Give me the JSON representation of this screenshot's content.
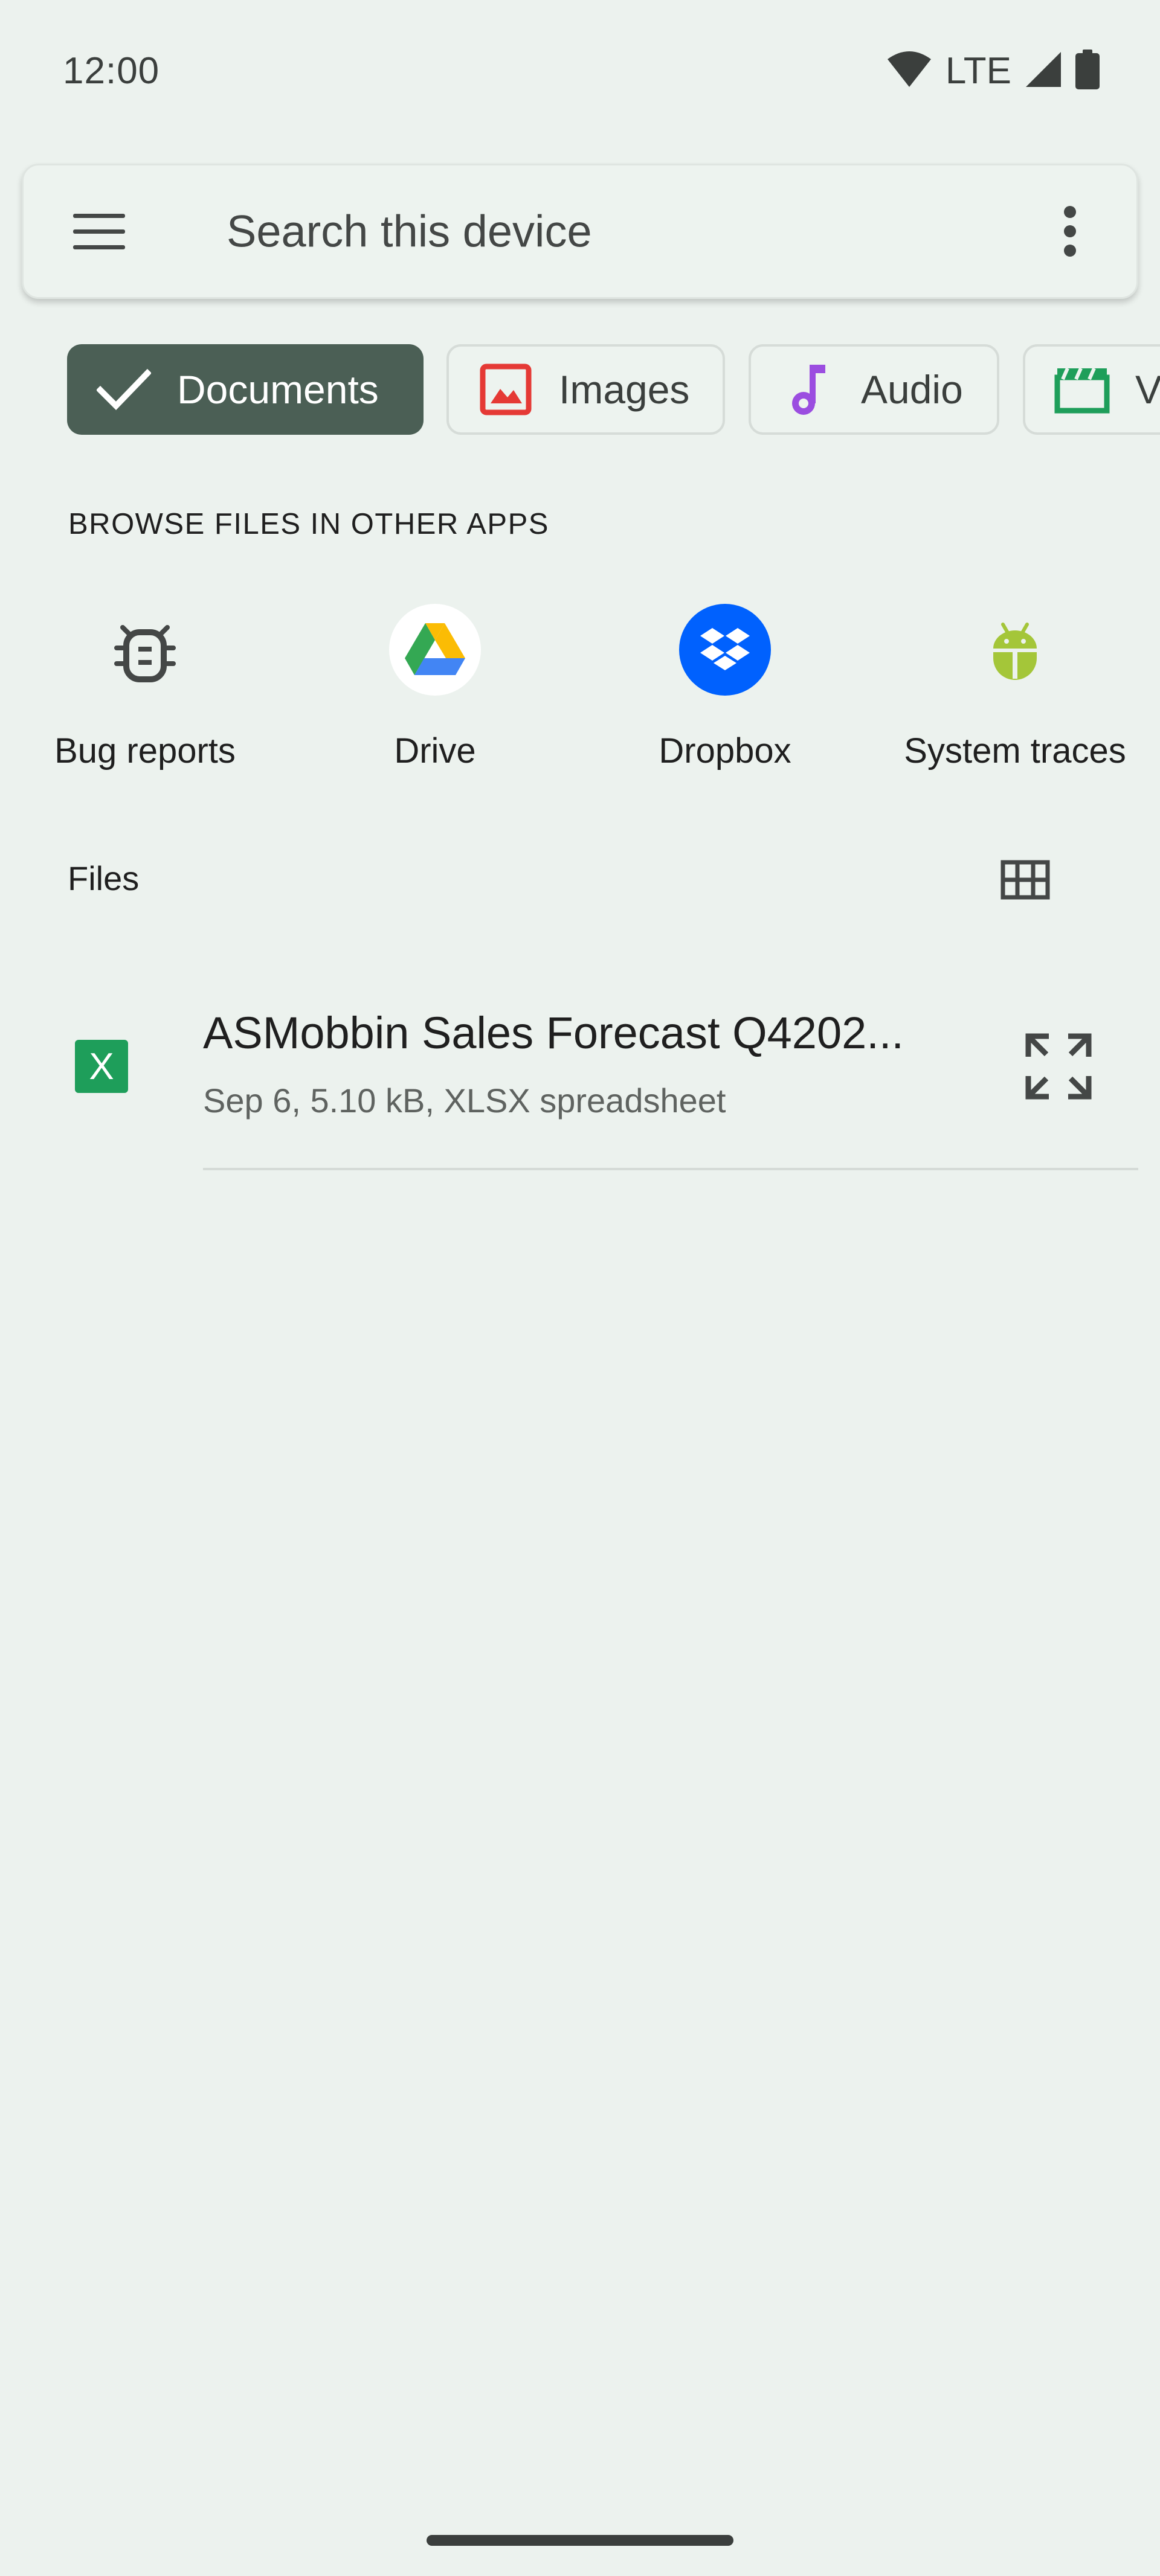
{
  "status_bar": {
    "time": "12:00",
    "network": "LTE"
  },
  "search": {
    "placeholder": "Search this device"
  },
  "chips": [
    {
      "label": "Documents",
      "selected": true
    },
    {
      "label": "Images",
      "selected": false
    },
    {
      "label": "Audio",
      "selected": false
    },
    {
      "label": "Videos",
      "selected": false,
      "visible_text": "V"
    }
  ],
  "other_apps": {
    "title": "BROWSE FILES IN OTHER APPS",
    "items": [
      {
        "label": "Bug reports",
        "icon": "bug-icon"
      },
      {
        "label": "Drive",
        "icon": "drive-icon"
      },
      {
        "label": "Dropbox",
        "icon": "dropbox-icon"
      },
      {
        "label": "System traces",
        "icon": "android-icon"
      }
    ]
  },
  "files": {
    "title": "Files",
    "items": [
      {
        "name": "ASMobbin Sales Forecast Q4202...",
        "meta": "Sep 6, 5.10 kB, XLSX spreadsheet",
        "icon_letter": "X"
      }
    ]
  },
  "colors": {
    "background": "#ecf2ee",
    "chip_active": "#4b5f55",
    "images_icon": "#e53935",
    "audio_icon": "#9b4de0",
    "video_icon": "#1e9e5a",
    "dropbox": "#0061fe",
    "android": "#a4c639",
    "xlsx": "#1e9e5a"
  }
}
